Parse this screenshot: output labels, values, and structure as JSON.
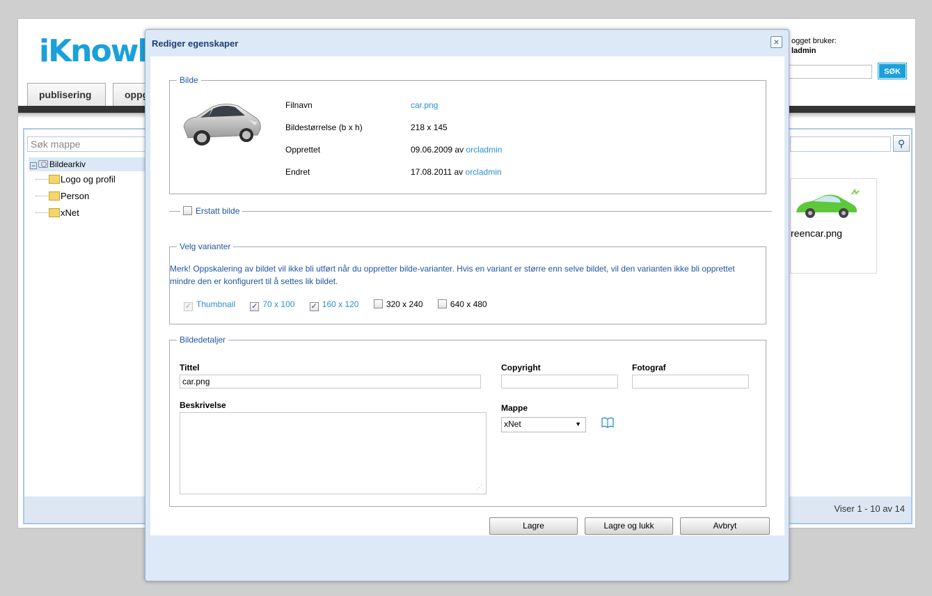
{
  "app": {
    "logo": "iKnowl",
    "tabs": [
      "publisering",
      "oppg"
    ],
    "user_label": "ogget bruker:",
    "user_name": "ladmin",
    "search_button": "SØK",
    "folder_search_placeholder": "Søk mappe",
    "tree": {
      "root": "Bildearkiv",
      "items": [
        "Logo og profil",
        "Person",
        "xNet"
      ]
    },
    "thumbnail_name": "reencar.png",
    "pager": "Viser 1 - 10 av 14"
  },
  "modal": {
    "title": "Rediger egenskaper",
    "close_icon": "×",
    "image_section": {
      "legend": "Bilde",
      "rows": [
        {
          "label": "Filnavn",
          "value": "car.png",
          "link": ""
        },
        {
          "label": "Bildestørrelse (b x h)",
          "value": "218 x 145",
          "link": ""
        },
        {
          "label": "Opprettet",
          "value": "09.06.2009 av ",
          "link": "orcladmin"
        },
        {
          "label": "Endret",
          "value": "17.08.2011 av ",
          "link": "orcladmin"
        }
      ]
    },
    "replace_label": "Erstatt bilde",
    "variants": {
      "legend": "Velg varianter",
      "note": "Merk! Oppskalering av bildet vil ikke bli utført når du oppretter bilde-varianter. Hvis en variant er større enn selve bildet, vil den varianten ikke bli opprettet mindre den er konfigurert til å settes lik bildet.",
      "options": [
        {
          "label": "Thumbnail",
          "checked": true,
          "disabled": true
        },
        {
          "label": "70 x 100",
          "checked": true,
          "disabled": false
        },
        {
          "label": "160 x 120",
          "checked": true,
          "disabled": false
        },
        {
          "label": "320 x 240",
          "checked": false,
          "disabled": false
        },
        {
          "label": "640 x 480",
          "checked": false,
          "disabled": false
        }
      ]
    },
    "details": {
      "legend": "Bildedetaljer",
      "title_label": "Tittel",
      "title_value": "car.png",
      "copyright_label": "Copyright",
      "copyright_value": "",
      "photographer_label": "Fotograf",
      "photographer_value": "",
      "description_label": "Beskrivelse",
      "description_value": "",
      "folder_label": "Mappe",
      "folder_value": "xNet"
    },
    "buttons": {
      "save": "Lagre",
      "save_close": "Lagre og lukk",
      "cancel": "Avbryt"
    }
  },
  "colors": {
    "brand": "#1aa0da",
    "link": "#2a8fd0",
    "legend_blue": "#1e56a0",
    "modal_frame": "#dde9f6"
  }
}
